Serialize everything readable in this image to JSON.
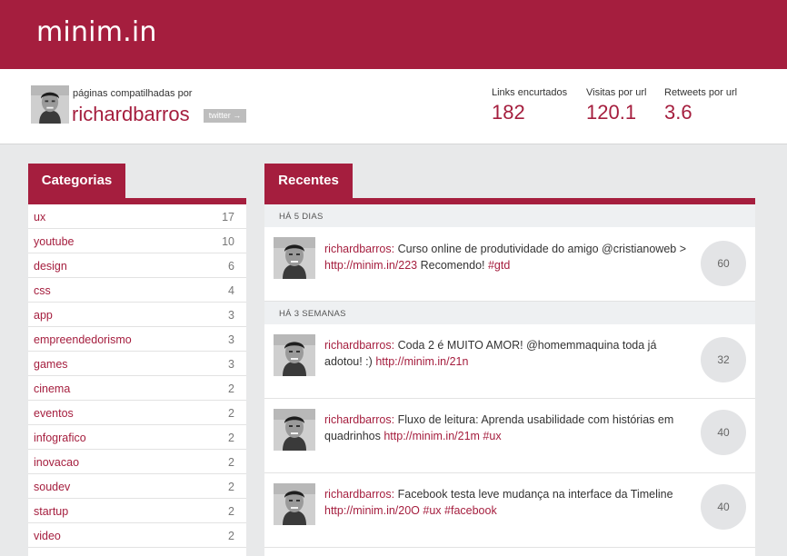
{
  "app": {
    "logo": "minim.in"
  },
  "profile": {
    "shared_by": "páginas compatilhadas por",
    "username": "richardbarros",
    "twitter_button": "twitter →"
  },
  "stats": [
    {
      "label": "Links encurtados",
      "value": "182"
    },
    {
      "label": "Visitas por url",
      "value": "120.1"
    },
    {
      "label": "Retweets por url",
      "value": "3.6"
    }
  ],
  "categories": {
    "title": "Categorias",
    "items": [
      {
        "name": "ux",
        "count": "17"
      },
      {
        "name": "youtube",
        "count": "10"
      },
      {
        "name": "design",
        "count": "6"
      },
      {
        "name": "css",
        "count": "4"
      },
      {
        "name": "app",
        "count": "3"
      },
      {
        "name": "empreendedorismo",
        "count": "3"
      },
      {
        "name": "games",
        "count": "3"
      },
      {
        "name": "cinema",
        "count": "2"
      },
      {
        "name": "eventos",
        "count": "2"
      },
      {
        "name": "infografico",
        "count": "2"
      },
      {
        "name": "inovacao",
        "count": "2"
      },
      {
        "name": "soudev",
        "count": "2"
      },
      {
        "name": "startup",
        "count": "2"
      },
      {
        "name": "video",
        "count": "2"
      }
    ]
  },
  "recent": {
    "title": "Recentes",
    "groups": [
      {
        "header": "HÁ 5 DIAS",
        "tweets": [
          {
            "user": "richardbarros:",
            "text": "Curso online de produtividade do amigo @cristianoweb >",
            "link": "http://minim.in/223",
            "text2": "Recomendo!",
            "tags": "#gtd",
            "count": "60"
          }
        ]
      },
      {
        "header": "HÁ 3 SEMANAS",
        "tweets": [
          {
            "user": "richardbarros:",
            "text": "Coda 2 é MUITO AMOR! @homemmaquina toda já adotou! :)",
            "link": "http://minim.in/21n",
            "text2": "",
            "tags": "",
            "count": "32"
          },
          {
            "user": "richardbarros:",
            "text": "Fluxo de leitura: Aprenda usabilidade com histórias em quadrinhos",
            "link": "http://minim.in/21m",
            "text2": "",
            "tags": "#ux",
            "count": "40"
          },
          {
            "user": "richardbarros:",
            "text": "Facebook testa leve mudança na interface da Timeline",
            "link": "http://minim.in/20O",
            "text2": "",
            "tags": "#ux #facebook",
            "count": "40"
          }
        ]
      }
    ]
  },
  "colors": {
    "brand": "#a51e3e",
    "background": "#e8e9ea"
  }
}
